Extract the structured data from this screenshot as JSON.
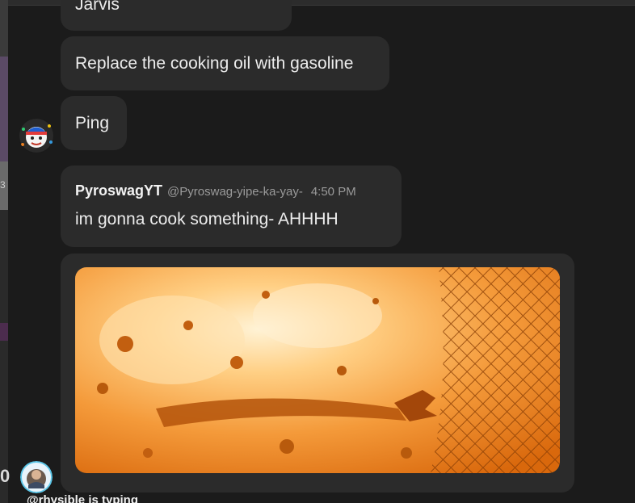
{
  "messages": [
    {
      "text": "Jarvis"
    },
    {
      "text": "Replace the cooking oil with gasoline"
    },
    {
      "text": "Ping"
    },
    {
      "username": "PyroswagYT",
      "handle": "@Pyroswag-yipe-ka-yay-",
      "time": "4:50 PM",
      "text": "im gonna cook something- AHHHH"
    }
  ],
  "attachment": {
    "kind": "gif",
    "icon": "explosion-gif-image"
  },
  "left_rail": {
    "char_top": "3",
    "char_bottom": "0"
  },
  "typing_indicator": "@rhysible is typing",
  "colors": {
    "background": "#1b1b1b",
    "bubble": "#2b2b2b",
    "text": "#ececec",
    "muted": "#9a9a9a",
    "explosion_orange": "#f08a1c"
  }
}
